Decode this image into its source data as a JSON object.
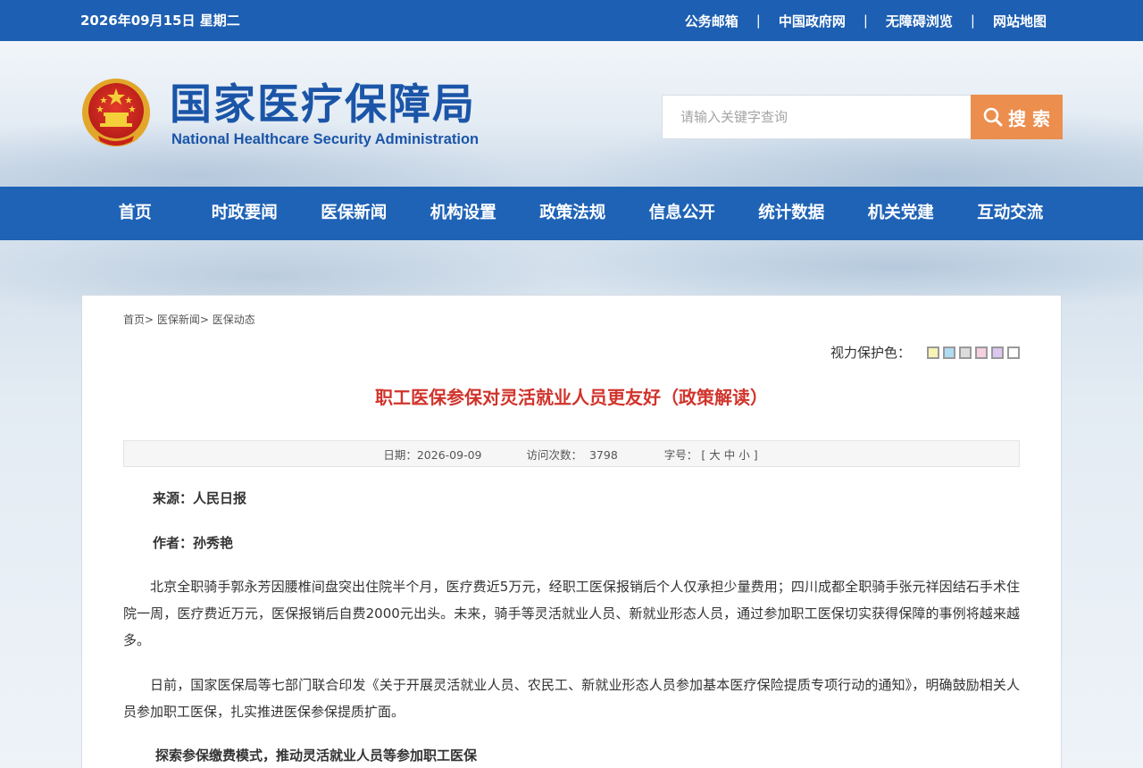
{
  "topbar": {
    "date": "2026年09月15日 星期二",
    "links": [
      "公务邮箱",
      "中国政府网",
      "无障碍浏览",
      "网站地图"
    ],
    "separator": "|"
  },
  "header": {
    "logo_cn": "国家医疗保障局",
    "logo_en": "National Healthcare Security Administration",
    "search_placeholder": "请输入关键字查询",
    "search_button": "搜 索"
  },
  "nav": {
    "items": [
      "首页",
      "时政要闻",
      "医保新闻",
      "机构设置",
      "政策法规",
      "信息公开",
      "统计数据",
      "机关党建",
      "互动交流"
    ]
  },
  "breadcrumb": [
    "首页>",
    "医保新闻>",
    "医保动态"
  ],
  "vision_protection": {
    "label": "视力保护色：",
    "swatches": [
      "#f7f3b5",
      "#aedcf2",
      "#dcdcdc",
      "#f6cfe0",
      "#dcc7f2",
      "#ffffff"
    ]
  },
  "article": {
    "title": "职工医保参保对灵活就业人员更友好（政策解读）",
    "meta": {
      "date_label": "日期：",
      "date": "2026-09-09",
      "visits_label": "访问次数：",
      "visits": "3798",
      "fontsize_label": "字号：",
      "fontsize_open": "[",
      "fontsize_large": "大",
      "fontsize_medium": "中",
      "fontsize_small": "小",
      "fontsize_close": "]"
    },
    "source": "来源：人民日报",
    "author": "作者：孙秀艳",
    "paragraphs": [
      "北京全职骑手郭永芳因腰椎间盘突出住院半个月，医疗费近5万元，经职工医保报销后个人仅承担少量费用；四川成都全职骑手张元祥因结石手术住院一周，医疗费近万元，医保报销后自费2000元出头。未来，骑手等灵活就业人员、新就业形态人员，通过参加职工医保切实获得保障的事例将越来越多。",
      "日前，国家医保局等七部门联合印发《关于开展灵活就业人员、农民工、新就业形态人员参加基本医疗保险提质专项行动的通知》，明确鼓励相关人员参加职工医保，扎实推进医保参保提质扩面。"
    ],
    "subheading": "探索参保缴费模式，推动灵活就业人员等参加职工医保"
  },
  "colors": {
    "topbar": "#1d5fb2",
    "nav": "#1f63b6",
    "brand_blue": "#1b55a8",
    "title_red": "#d0342c",
    "search_button": "#ec8e4e"
  }
}
